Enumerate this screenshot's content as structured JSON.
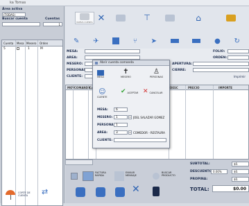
{
  "window": {
    "title": "ka Tomas"
  },
  "left": {
    "area_label": "Área activa",
    "area_value": "(TODAS)",
    "search_label": "Buscar cuenta",
    "cuentas_label": "Cuentas",
    "cuentas_count": "1",
    "columns": [
      "Cuenta",
      "Mesa",
      "Mesero",
      "Orden"
    ],
    "row": [
      "5",
      "",
      "1",
      "M"
    ]
  },
  "toolbar": {
    "items": [
      {
        "label": "NUEVA CUENTA",
        "icon": "new-account-icon"
      },
      {
        "label": "CANCELAR",
        "icon": "cancel-icon"
      },
      {
        "label": "MESAS",
        "icon": "tables-icon"
      },
      {
        "label": "JUNTAR",
        "icon": "join-icon"
      },
      {
        "label": "CAMBIAR",
        "icon": "change-icon"
      },
      {
        "label": "ABRIR",
        "icon": "open-icon"
      },
      {
        "label": "COBRAR",
        "icon": "charge-icon"
      }
    ]
  },
  "info": {
    "mesa": "MESA:",
    "area": "AREA:",
    "mesero": "MESERO:",
    "personas": "PERSONAS:",
    "cliente": "CLIENTE:",
    "folio": "FOLIO:",
    "orden": "ORDEN:",
    "apertura": "APERTURA:",
    "cierre": "CIERRE:",
    "imprimir": "Imprimir"
  },
  "grid": {
    "columns": [
      "MOV",
      "COMANDA",
      "CAN",
      "DESC",
      "PRECIO",
      "IMPORTE"
    ]
  },
  "dialog": {
    "title": "Abrir cuenta comanda",
    "buttons": [
      {
        "label": "MESA",
        "icon": "table-icon"
      },
      {
        "label": "MESERO",
        "icon": "waiter-icon"
      },
      {
        "label": "PERSONAS",
        "icon": "person-icon"
      },
      {
        "label": "CLIENTE",
        "icon": "client-icon"
      },
      {
        "label": "ACEPTAR",
        "icon": "check-icon"
      },
      {
        "label": "CANCELAR",
        "icon": "cancel-icon"
      }
    ],
    "fields": {
      "mesa_label": "MESA:",
      "mesa_value": "6",
      "mesero_label": "MESERO:",
      "mesero_value": "1",
      "mesero_name": "JOEL SALAZAR GOMEZ",
      "personas_label": "PERSONAS:",
      "personas_value": "1",
      "area_label": "AREA:",
      "area_value": "3",
      "area_name": "COMEDOR - RESTAURA",
      "cliente_label": "CLIENTE:",
      "cliente_value": ""
    }
  },
  "bottom": {
    "buttons": [
      "FACTURA RAPIDA",
      "ENVIAR MENSAJE",
      "BUSCAR PRODUCTO",
      "CANCELAR",
      "CORTE DE CUENTA"
    ],
    "subtotal": "SUBTOTAL:",
    "descuento": "DESCUENTO:",
    "descuento_pct": "0.00%",
    "propina": "PROPINA:",
    "total": "TOTAL:",
    "total_value": "$0.00",
    "subtotal_value": "$0.",
    "descuento_value": "$0.",
    "propina_value": "$0."
  },
  "accent": "#2f64b3"
}
